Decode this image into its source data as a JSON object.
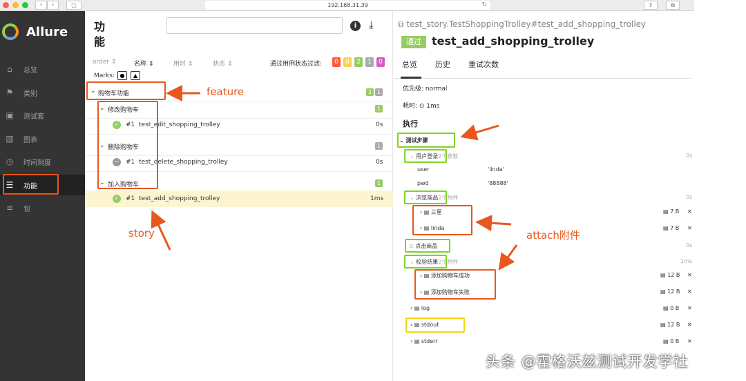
{
  "browser": {
    "url": "192.168.31.39",
    "nav_back": "‹",
    "nav_fwd": "›",
    "reload": "↻"
  },
  "sidebar": {
    "logo": "Allure",
    "items": [
      {
        "label": "总览",
        "icon": "home-icon"
      },
      {
        "label": "类别",
        "icon": "flag-icon"
      },
      {
        "label": "测试套",
        "icon": "briefcase-icon"
      },
      {
        "label": "图表",
        "icon": "bar-chart-icon"
      },
      {
        "label": "时间刻度",
        "icon": "clock-icon"
      },
      {
        "label": "功能",
        "icon": "list-icon"
      },
      {
        "label": "包",
        "icon": "package-icon"
      }
    ]
  },
  "main": {
    "title": "功能",
    "search_placeholder": "",
    "columns": {
      "order": "order",
      "name": "名称",
      "duration": "用时",
      "status": "状态"
    },
    "filter_label": "通过用例状态过滤:",
    "filter_counts": [
      "0",
      "0",
      "2",
      "1",
      "0"
    ],
    "filter_colors": [
      "#fd5a3e",
      "#ffd050",
      "#97cc64",
      "#aaaaaa",
      "#d35ebe"
    ],
    "marks_label": "Marks:",
    "tree": {
      "feature": {
        "name": "购物车功能",
        "passed": "2",
        "skipped": "1"
      },
      "stories": [
        {
          "name": "修改购物车",
          "count": "1",
          "count_color": "#97cc64",
          "test": {
            "num": "#1",
            "name": "test_edit_shopping_trolley",
            "time": "0s",
            "status": "passed"
          }
        },
        {
          "name": "删除购物车",
          "count": "1",
          "count_color": "#aaaaaa",
          "test": {
            "num": "#1",
            "name": "test_delete_shopping_trolley",
            "time": "0s",
            "status": "skipped"
          }
        },
        {
          "name": "加入购物车",
          "count": "1",
          "count_color": "#97cc64",
          "test": {
            "num": "#1",
            "name": "test_add_shopping_trolley",
            "time": "1ms",
            "status": "passed"
          }
        }
      ]
    }
  },
  "detail": {
    "path": "test_story.TestShoppingTrolley#test_add_shopping_trolley",
    "status_badge": "通过",
    "status_color": "#97cc64",
    "title": "test_add_shopping_trolley",
    "tabs": [
      "总览",
      "历史",
      "重试次数"
    ],
    "priority": "优先级: normal",
    "duration": "耗时: ⊙ 1ms",
    "exec_heading": "执行",
    "steps_label": "测试步骤",
    "steps": {
      "login": {
        "name": "用户登录",
        "note": "2个参数",
        "time": "0s"
      },
      "params": [
        {
          "k": "user",
          "v": "'linda'"
        },
        {
          "k": "pwd",
          "v": "'88888'"
        }
      ],
      "browse": {
        "name": "浏览商品",
        "note": "2个附件",
        "time": "0s"
      },
      "browse_att": [
        {
          "name": "三星",
          "size": "7 B"
        },
        {
          "name": "linda",
          "size": "7 B"
        }
      ],
      "click": {
        "name": "点击商品",
        "time": "0s"
      },
      "verify": {
        "name": "校验结果",
        "note": "2个附件",
        "time": "1ms"
      },
      "verify_att": [
        {
          "name": "添加购物车成功",
          "size": "12 B"
        },
        {
          "name": "添加购物车失败",
          "size": "12 B"
        }
      ],
      "logs": [
        {
          "name": "log",
          "size": "0 B"
        },
        {
          "name": "stdout",
          "size": "12 B"
        },
        {
          "name": "stderr",
          "size": "0 B"
        }
      ]
    }
  },
  "annotations": {
    "feature": "feature",
    "story": "story",
    "attach": "attach附件"
  },
  "watermark": "头条 @霍格沃兹测试开发学社"
}
